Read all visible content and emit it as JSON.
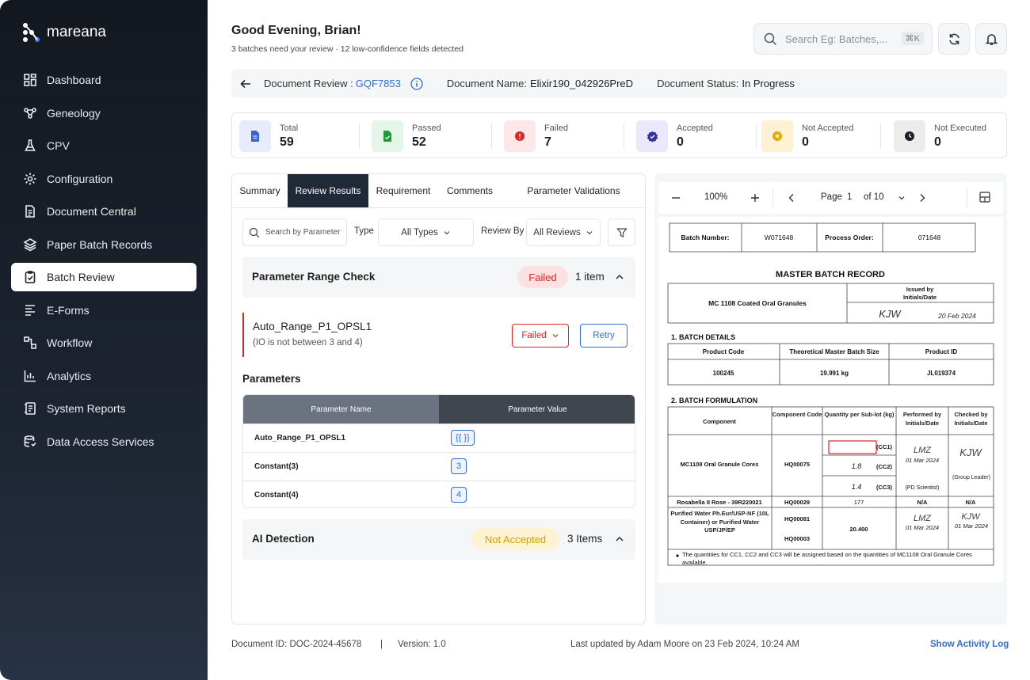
{
  "brand": {
    "name": "mareana"
  },
  "sidebar": {
    "items": [
      {
        "label": "Dashboard",
        "icon": "grid-icon"
      },
      {
        "label": "Geneology",
        "icon": "genealogy-icon"
      },
      {
        "label": "CPV",
        "icon": "flask-icon"
      },
      {
        "label": "Configuration",
        "icon": "gear-icon"
      },
      {
        "label": "Document Central",
        "icon": "document-icon"
      },
      {
        "label": "Paper Batch Records",
        "icon": "layers-icon"
      },
      {
        "label": "Batch Review",
        "icon": "clipboard-check-icon",
        "active": true
      },
      {
        "label": "E-Forms",
        "icon": "form-icon"
      },
      {
        "label": "Workflow",
        "icon": "workflow-icon"
      },
      {
        "label": "Analytics",
        "icon": "bar-chart-icon"
      },
      {
        "label": "System Reports",
        "icon": "report-icon"
      },
      {
        "label": "Data Access Services",
        "icon": "database-icon"
      }
    ]
  },
  "header": {
    "greeting": "Good Evening, Brian!",
    "subtitle": "3 batches need your review · 12 low-confidence fields detected",
    "search_placeholder": "Search Eg: Batches,...",
    "search_shortcut": "⌘K"
  },
  "docbar": {
    "review_label": "Document Review :",
    "review_id": "GQF7853",
    "name_label": "Document Name:",
    "name_value": "Elixir190_042926PreD",
    "status_label": "Document Status:",
    "status_value": "In Progress"
  },
  "stats": [
    {
      "label": "Total",
      "value": "59",
      "bg": "#e6ecfb",
      "fg": "#3b63d6",
      "icon": "file-icon"
    },
    {
      "label": "Passed",
      "value": "52",
      "bg": "#e4f6e7",
      "fg": "#1f9a3a",
      "icon": "file-check-icon"
    },
    {
      "label": "Failed",
      "value": "7",
      "bg": "#fde7e7",
      "fg": "#e02424",
      "icon": "alert-icon"
    },
    {
      "label": "Accepted",
      "value": "0",
      "bg": "#ebe8fb",
      "fg": "#3730a3",
      "icon": "badge-check-icon"
    },
    {
      "label": "Not Accepted",
      "value": "0",
      "bg": "#fdf1d3",
      "fg": "#e0a800",
      "icon": "x-circle-icon"
    },
    {
      "label": "Not Executed",
      "value": "0",
      "bg": "#ececec",
      "fg": "#1c1f26",
      "icon": "clock-icon"
    }
  ],
  "tabs": [
    "Summary",
    "Review Results",
    "Requirement",
    "Comments",
    "Parameter Validations"
  ],
  "filters": {
    "search_placeholder": "Search by Parameter",
    "type_label": "Type",
    "type_value": "All Types",
    "review_label": "Review By",
    "review_value": "All Reviews"
  },
  "range_check": {
    "title": "Parameter Range Check",
    "status": "Failed",
    "count": "1 item",
    "item_name": "Auto_Range_P1_OPSL1",
    "item_sub": "(IO is not between 3 and 4)",
    "item_status": "Failed",
    "retry": "Retry"
  },
  "parameters": {
    "title": "Parameters",
    "col_name": "Parameter Name",
    "col_value": "Parameter Value",
    "rows": [
      {
        "name": "Auto_Range_P1_OPSL1",
        "value": "{{ }}"
      },
      {
        "name": "Constant(3)",
        "value": "3"
      },
      {
        "name": "Constant(4)",
        "value": "4"
      }
    ]
  },
  "ai_detection": {
    "title": "AI Detection",
    "status": "Not Accepted",
    "count": "3 Items"
  },
  "viewer": {
    "zoom": "100%",
    "page_label": "Page",
    "page": "1",
    "of": "of 10"
  },
  "record": {
    "batch_number_label": "Batch Number:",
    "batch_number": "W071648",
    "process_order_label": "Process Order:",
    "process_order": "071648",
    "title": "MASTER BATCH RECORD",
    "product_name": "MC 1108 Coated Oral Granules",
    "issued_by": "Issued by",
    "initials_date": "Initials/Date",
    "issued_sig": "KJW",
    "issued_date": "20 Feb 2024",
    "sec1": "1.   BATCH DETAILS",
    "bd_headers": [
      "Product Code",
      "Theoretical Master Batch Size",
      "Product ID"
    ],
    "bd_values": [
      "100245",
      "19.991 kg",
      "JL019374"
    ],
    "sec2": "2.   BATCH FORMULATION",
    "bf_headers": [
      "Component",
      "Component Code",
      "Quantity per Sub-lot (kg)",
      "Performed by Initials/Date",
      "Checked by Initials/Date"
    ],
    "row1_component": "MC1108 Oral Granule Cores",
    "row1_code": "HQ00075",
    "row1_q1": "(CC1)",
    "row1_q2_val": "1.8",
    "row1_q2": "(CC2)",
    "row1_q3_val": "1.4",
    "row1_q3": "(CC3)",
    "row1_perf_sig": "LMZ",
    "row1_perf_date": "01 Mar 2024",
    "row1_perf_role": "(PD Scientist)",
    "row1_check_sig": "KJW",
    "row1_check_role": "(Group Leader)",
    "row2_component": "Rosabella II Rose - 39R220021",
    "row2_code": "HQ00029",
    "row2_qty": "177",
    "row2_perf": "N/A",
    "row2_check": "N/A",
    "row3_component": "Purified Water Ph.Eur/USP-NF (10L Container) or Purified Water USP/JP/EP",
    "row3_code1": "HQ00081",
    "row3_code2": "HQ00003",
    "row3_qty": "20.400",
    "row3_perf_sig": "LMZ",
    "row3_perf_date": "01 Mar 2024",
    "row3_check_sig": "KJW",
    "row3_check_date": "01 Mar 2024",
    "note": "The quantities for CC1, CC2 and CC3 will be assigned based on the quantities of MC1108 Oral Granule Cores available."
  },
  "footer": {
    "doc_id": "Document ID: DOC-2024-45678",
    "sep": "|",
    "version": "Version: 1.0",
    "updated": "Last updated by Adam Moore on 23 Feb 2024, 10:24 AM",
    "activity": "Show Activity Log"
  }
}
